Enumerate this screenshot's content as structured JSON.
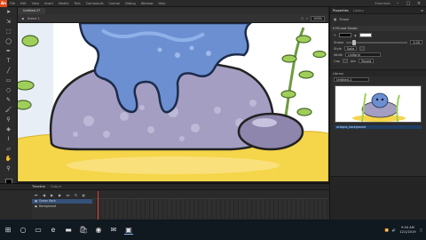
{
  "app": {
    "logo": "An",
    "menus": [
      "File",
      "Edit",
      "View",
      "Insert",
      "Modify",
      "Text",
      "Commands",
      "Control",
      "Debug",
      "Window",
      "Help"
    ],
    "workspace": "Essentials"
  },
  "document": {
    "tab": "Untitled-1*",
    "scene": "Scene 1",
    "zoom": "100%"
  },
  "tools": [
    "arrow-icon",
    "subselect-icon",
    "transform-icon",
    "lasso-icon",
    "pen-icon",
    "text-icon",
    "line-icon",
    "rect-icon",
    "oval-icon",
    "pencil-icon",
    "brush-icon",
    "bone-icon",
    "bucket-icon",
    "eyedropper-icon",
    "eraser-icon",
    "hand-icon",
    "zoom-icon"
  ],
  "properties": {
    "tabs": [
      "Properties",
      "Library"
    ],
    "object": "Shape",
    "section_fill": "Fill and Stroke",
    "stroke_label": "Stroke",
    "stroke_value": "3.00",
    "style_label": "Style",
    "style_value": "Solid",
    "width_label": "Width",
    "width_value": "Uniform",
    "cap_label": "Cap",
    "join_label": "Join",
    "join_value": "Round"
  },
  "library": {
    "title": "Library",
    "doc": "Untitled-1",
    "item": "octopus_background"
  },
  "timeline": {
    "tabs": [
      "Timeline",
      "Output"
    ],
    "layers": [
      "Ocean Rock",
      "Background"
    ]
  },
  "taskbar": {
    "time": "9:54 AM",
    "date": "12/1/2019"
  },
  "colors": {
    "stage_bg": "#ffffff",
    "rock": "#a39ec2",
    "tentacle": "#6b8fd1",
    "sand": "#f5d54a",
    "seaweed": "#9fcf5a"
  }
}
